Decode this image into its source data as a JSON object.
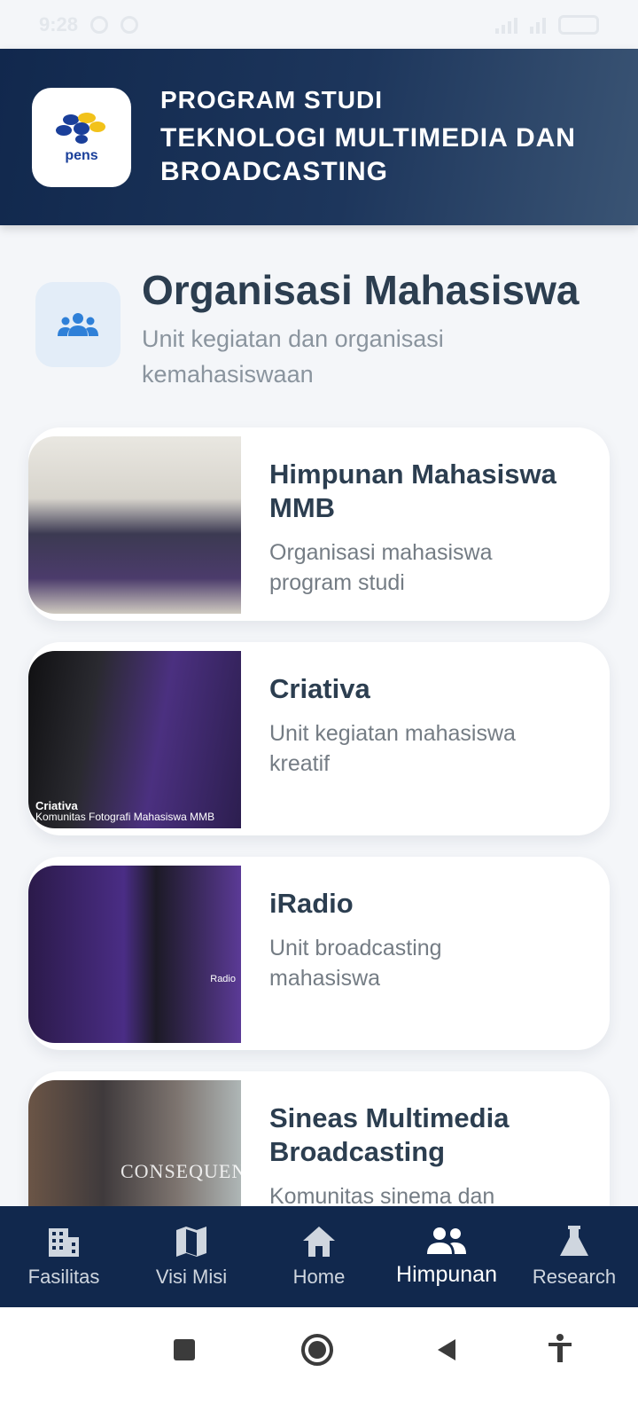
{
  "status_bar": {
    "time": "9:28"
  },
  "header": {
    "program_label": "PROGRAM STUDI",
    "program_name": "TEKNOLOGI MULTIMEDIA DAN BROADCASTING",
    "logo_text": "pens"
  },
  "section": {
    "title": "Organisasi Mahasiswa",
    "description": "Unit kegiatan dan organisasi kemahasiswaan",
    "icon": "group-icon"
  },
  "organizations": [
    {
      "title": "Himpunan Mahasiswa MMB",
      "description": "Organisasi mahasiswa program studi"
    },
    {
      "title": "Criativa",
      "description": "Unit kegiatan mahasiswa kreatif",
      "image_caption_title": "Criativa",
      "image_caption_sub": "Komunitas Fotografi Mahasiswa MMB"
    },
    {
      "title": "iRadio",
      "description": "Unit broadcasting mahasiswa",
      "image_caption_title": "Radio"
    },
    {
      "title": "Sineas Multimedia Broadcasting",
      "description": "Komunitas sinema dan multimedia",
      "image_caption_title": "CONSEQUEN"
    }
  ],
  "bottom_nav": {
    "active": "Himpunan",
    "items": [
      {
        "label": "Fasilitas",
        "icon": "building-icon"
      },
      {
        "label": "Visi Misi",
        "icon": "map-icon"
      },
      {
        "label": "Home",
        "icon": "home-icon"
      },
      {
        "label": "Himpunan",
        "icon": "group-icon"
      },
      {
        "label": "Research",
        "icon": "flask-icon"
      }
    ]
  },
  "colors": {
    "primary_dark": "#11284d",
    "background": "#f4f6f9",
    "title_text": "#2c3e50",
    "muted_text": "#8a949e",
    "accent_blue": "#2f80d8"
  }
}
